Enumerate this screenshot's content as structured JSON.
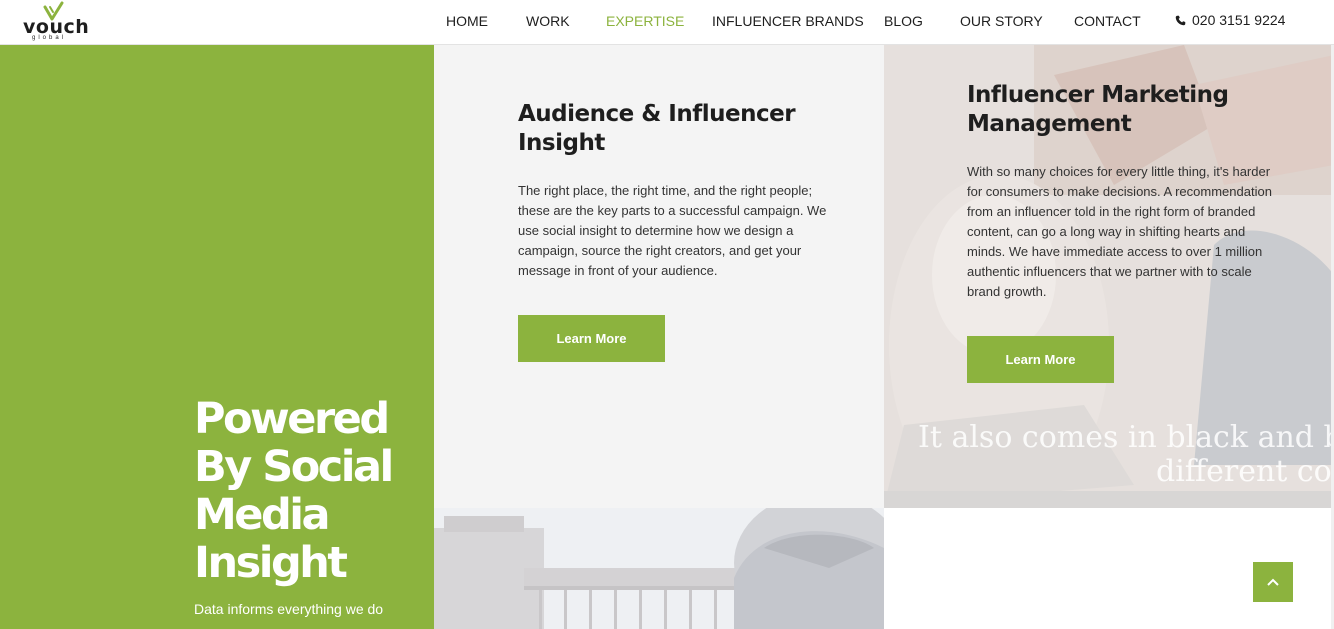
{
  "logo": {
    "word": "vouch",
    "sub": "global"
  },
  "nav": {
    "items": [
      {
        "label": "HOME",
        "active": false
      },
      {
        "label": "WORK",
        "active": false
      },
      {
        "label": "EXPERTISE",
        "active": true
      },
      {
        "label": "INFLUENCER BRANDS",
        "active": false
      },
      {
        "label": "BLOG",
        "active": false
      },
      {
        "label": "OUR STORY",
        "active": false
      },
      {
        "label": "CONTACT",
        "active": false
      }
    ],
    "phone": "020 3151 9224",
    "phone_icon": "phone-icon"
  },
  "hero": {
    "title": "Powered By Social Media Insight",
    "subtitle": "Data informs everything we do"
  },
  "cards": [
    {
      "title": "Audience & Influencer Insight",
      "body": "The right place, the right time, and the right people; these are the key parts to a successful campaign. We use social insight to determine how we design a campaign, source the right creators, and get your message in front of your audience.",
      "button": "Learn More"
    },
    {
      "title": "Influencer Marketing Management",
      "body": "With so many choices for every little thing, it's harder for consumers to make decisions. A recommendation from an influencer told in the right form of branded content, can go a long way in shifting hearts and minds. We have immediate access to over 1 million authentic influencers that we partner with to scale brand growth.",
      "button": "Learn More"
    }
  ],
  "photo_text": {
    "line1": "It also comes in black and b",
    "line2": "different col"
  },
  "scroll_top_icon": "chevron-up-icon",
  "colors": {
    "accent": "#8cb33e",
    "text_dark": "#1e1e1e",
    "card_bg": "#f4f4f4"
  }
}
